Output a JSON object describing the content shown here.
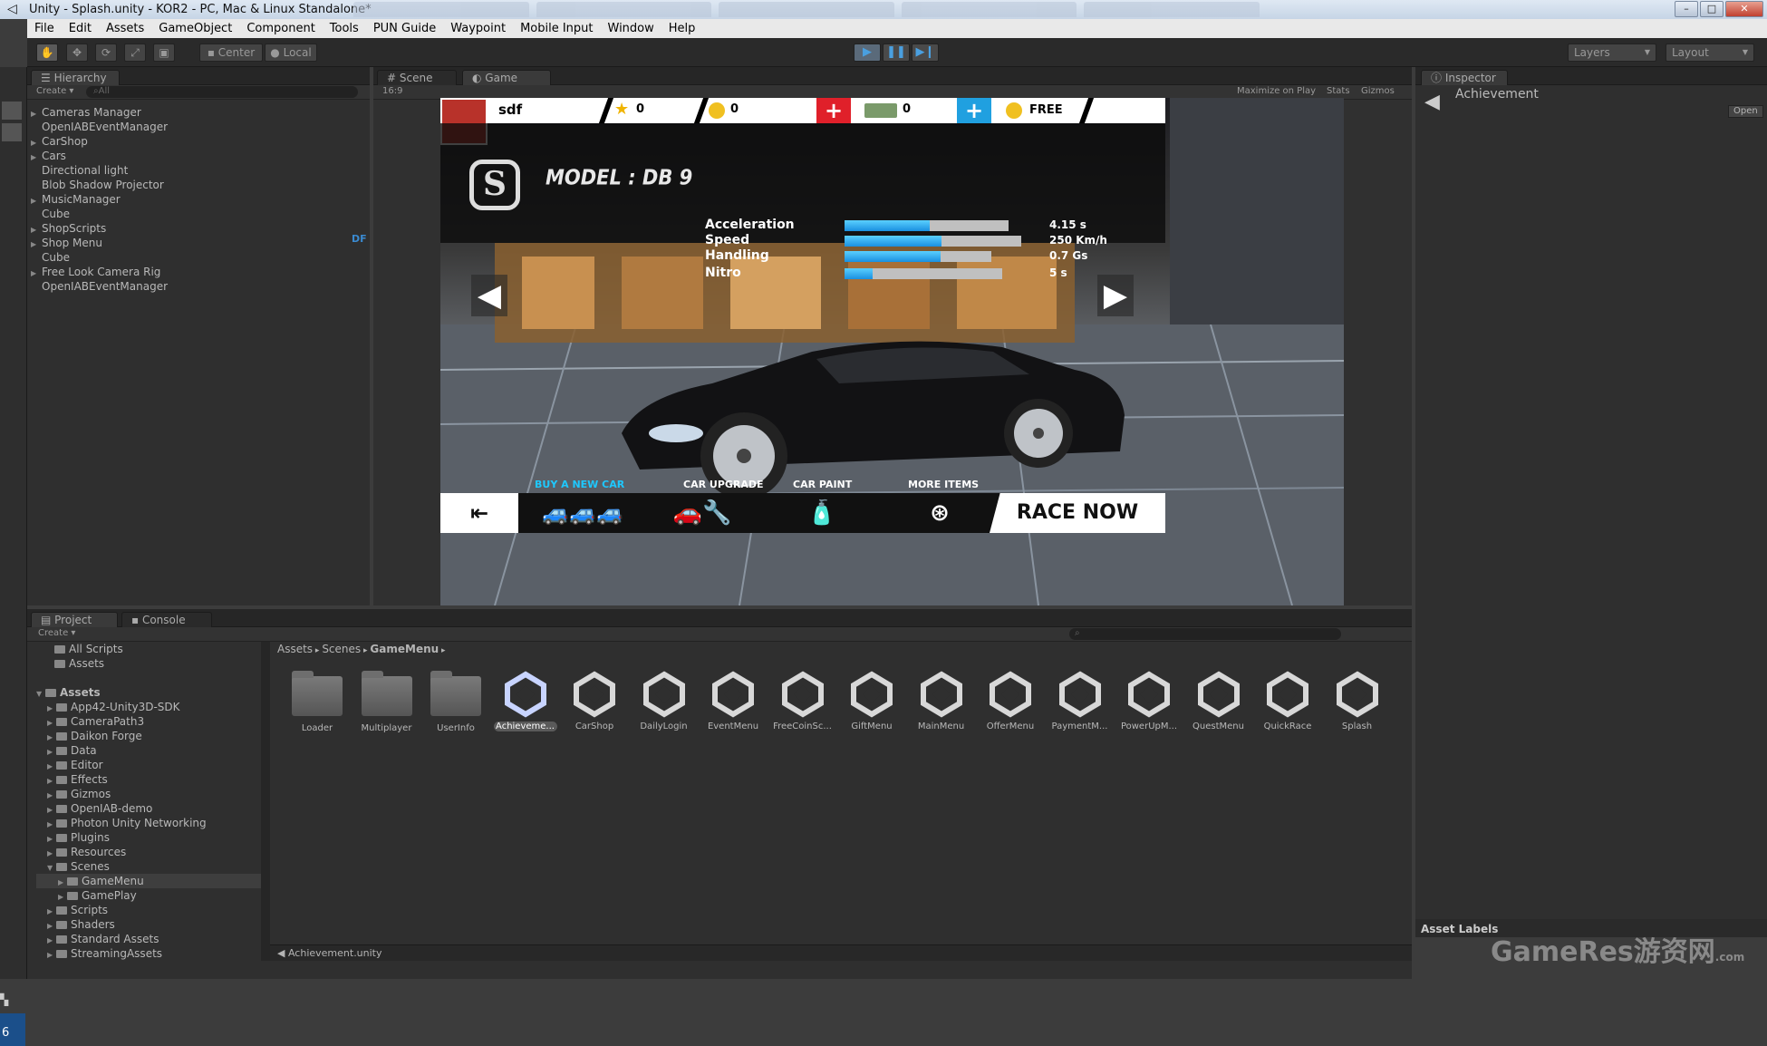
{
  "window": {
    "title": "Unity - Splash.unity - KOR2 - PC, Mac & Linux Standalone*"
  },
  "menu": [
    "File",
    "Edit",
    "Assets",
    "GameObject",
    "Component",
    "Tools",
    "PUN Guide",
    "Waypoint",
    "Mobile Input",
    "Window",
    "Help"
  ],
  "toolbar": {
    "center": "Center",
    "local": "Local",
    "layers": "Layers",
    "layout": "Layout"
  },
  "hierarchy": {
    "tab": "Hierarchy",
    "create": "Create",
    "search_placeholder": "All",
    "items": [
      {
        "label": "Cameras Manager",
        "expandable": true
      },
      {
        "label": "OpenIABEventManager",
        "expandable": false
      },
      {
        "label": "CarShop",
        "expandable": true
      },
      {
        "label": "Cars",
        "expandable": true
      },
      {
        "label": "Directional light",
        "expandable": false
      },
      {
        "label": "Blob Shadow Projector",
        "expandable": false
      },
      {
        "label": "MusicManager",
        "expandable": true
      },
      {
        "label": "Cube",
        "expandable": false
      },
      {
        "label": "ShopScripts",
        "expandable": true
      },
      {
        "label": "Shop Menu",
        "expandable": true
      },
      {
        "label": "Cube",
        "expandable": false
      },
      {
        "label": "Free Look Camera Rig",
        "expandable": true
      },
      {
        "label": "OpenIABEventManager",
        "expandable": false
      }
    ],
    "df_badge": "DF"
  },
  "scene_tabs": {
    "scene": "Scene",
    "game": "Game",
    "aspect": "16:9",
    "maximize": "Maximize on Play",
    "stats": "Stats",
    "gizmos": "Gizmos"
  },
  "game": {
    "player_name": "sdf",
    "stars": "0",
    "coins": "0",
    "cash": "0",
    "free": "FREE",
    "model": "MODEL : DB 9",
    "logo": "S",
    "stats": [
      {
        "label": "Acceleration",
        "value": "4.15 s",
        "fill": 0.52,
        "bar_w": 0.78
      },
      {
        "label": "Speed",
        "value": "250 Km/h",
        "fill": 0.55,
        "bar_w": 0.84
      },
      {
        "label": "Handling",
        "value": "0.7 Gs",
        "fill": 0.65,
        "bar_w": 0.7
      },
      {
        "label": "Nitro",
        "value": "5 s",
        "fill": 0.18,
        "bar_w": 0.75
      }
    ],
    "buy_new_car": "BUY A NEW CAR",
    "car_upgrade": "CAR UPGRADE",
    "car_paint": "CAR PAINT",
    "more_items": "MORE ITEMS",
    "race_now": "RACE NOW"
  },
  "inspector": {
    "tab": "Inspector",
    "title": "Achievement",
    "open": "Open",
    "asset_labels": "Asset Labels"
  },
  "project": {
    "tab": "Project",
    "console_tab": "Console",
    "create": "Create",
    "favorites": [
      "All Scripts",
      "Assets"
    ],
    "tree": [
      {
        "label": "Assets",
        "depth": 0,
        "bold": true
      },
      {
        "label": "App42-Unity3D-SDK",
        "depth": 1
      },
      {
        "label": "CameraPath3",
        "depth": 1
      },
      {
        "label": "Daikon Forge",
        "depth": 1
      },
      {
        "label": "Data",
        "depth": 1
      },
      {
        "label": "Editor",
        "depth": 1
      },
      {
        "label": "Effects",
        "depth": 1
      },
      {
        "label": "Gizmos",
        "depth": 1
      },
      {
        "label": "OpenIAB-demo",
        "depth": 1
      },
      {
        "label": "Photon Unity Networking",
        "depth": 1
      },
      {
        "label": "Plugins",
        "depth": 1
      },
      {
        "label": "Resources",
        "depth": 1
      },
      {
        "label": "Scenes",
        "depth": 1
      },
      {
        "label": "GameMenu",
        "depth": 2,
        "selected": true
      },
      {
        "label": "GamePlay",
        "depth": 2
      },
      {
        "label": "Scripts",
        "depth": 1
      },
      {
        "label": "Shaders",
        "depth": 1
      },
      {
        "label": "Standard Assets",
        "depth": 1
      },
      {
        "label": "StreamingAssets",
        "depth": 1
      }
    ],
    "breadcrumb": [
      "Assets",
      "Scenes",
      "GameMenu"
    ],
    "assets": [
      {
        "label": "Loader",
        "kind": "folder"
      },
      {
        "label": "Multiplayer",
        "kind": "folder"
      },
      {
        "label": "UserInfo",
        "kind": "folder"
      },
      {
        "label": "Achieveme...",
        "kind": "unity",
        "selected": true
      },
      {
        "label": "CarShop",
        "kind": "unity"
      },
      {
        "label": "DailyLogin",
        "kind": "unity"
      },
      {
        "label": "EventMenu",
        "kind": "unity"
      },
      {
        "label": "FreeCoinSc...",
        "kind": "unity"
      },
      {
        "label": "GiftMenu",
        "kind": "unity"
      },
      {
        "label": "MainMenu",
        "kind": "unity"
      },
      {
        "label": "OfferMenu",
        "kind": "unity"
      },
      {
        "label": "PaymentM...",
        "kind": "unity"
      },
      {
        "label": "PowerUpM...",
        "kind": "unity"
      },
      {
        "label": "QuestMenu",
        "kind": "unity"
      },
      {
        "label": "QuickRace",
        "kind": "unity"
      },
      {
        "label": "Splash",
        "kind": "unity"
      }
    ],
    "status_file": "Achievement.unity"
  },
  "watermark": "GameRes游资网",
  "watermark_sub": ".com",
  "corner_number": "6"
}
